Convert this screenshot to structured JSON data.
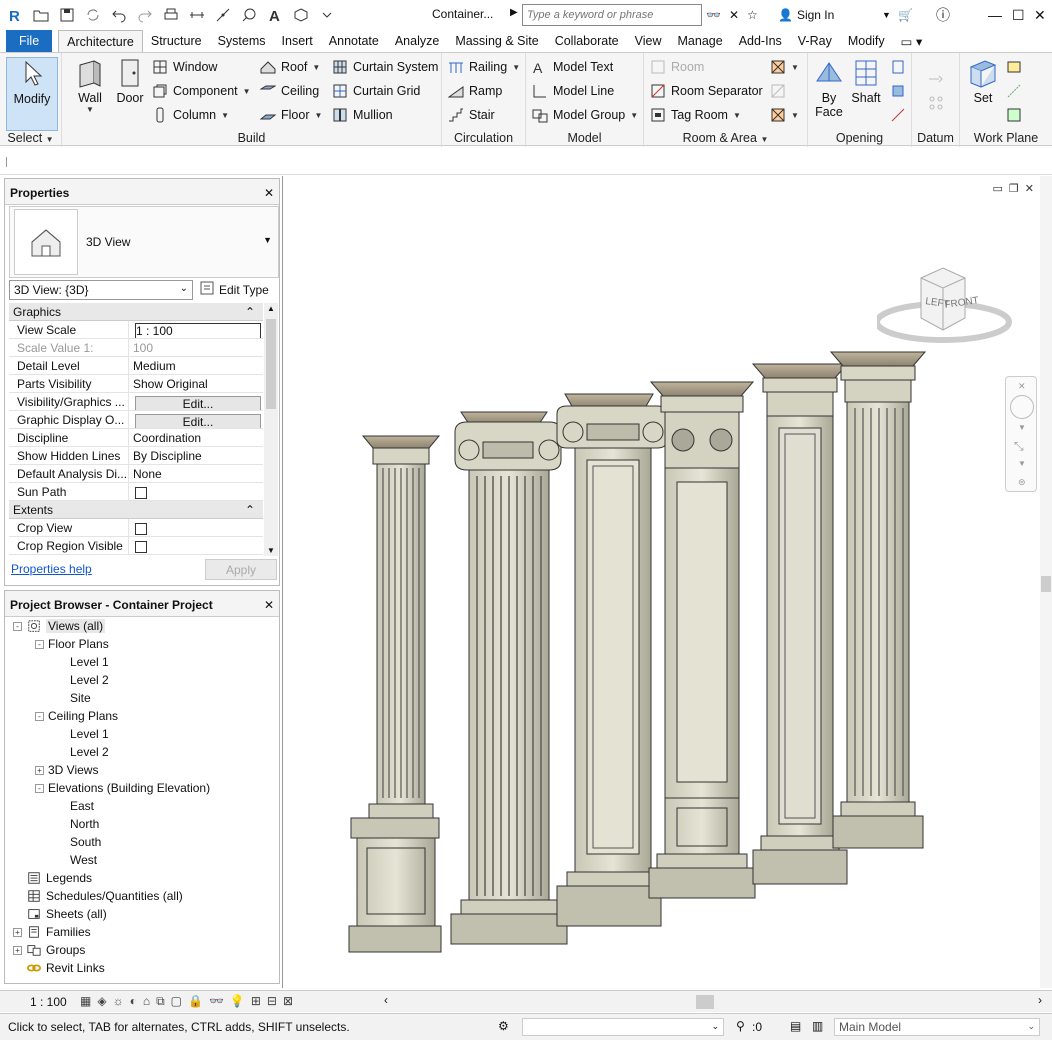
{
  "app": {
    "title": "Container...",
    "search_placeholder": "Type a keyword or phrase",
    "sign_in": "Sign In",
    "accent": "#1b6dc1"
  },
  "tabs": [
    {
      "label": "File"
    },
    {
      "label": "Architecture"
    },
    {
      "label": "Structure"
    },
    {
      "label": "Systems"
    },
    {
      "label": "Insert"
    },
    {
      "label": "Annotate"
    },
    {
      "label": "Analyze"
    },
    {
      "label": "Massing & Site"
    },
    {
      "label": "Collaborate"
    },
    {
      "label": "View"
    },
    {
      "label": "Manage"
    },
    {
      "label": "Add-Ins"
    },
    {
      "label": "V-Ray"
    },
    {
      "label": "Modify"
    }
  ],
  "ribbon": {
    "select": {
      "modify": "Modify",
      "label": "Select"
    },
    "build": {
      "label": "Build",
      "wall": "Wall",
      "door": "Door",
      "window": "Window",
      "component": "Component",
      "column": "Column",
      "roof": "Roof",
      "ceiling": "Ceiling",
      "floor": "Floor",
      "curtain_system": "Curtain  System",
      "curtain_grid": "Curtain  Grid",
      "mullion": "Mullion"
    },
    "circulation": {
      "label": "Circulation",
      "railing": "Railing",
      "ramp": "Ramp",
      "stair": "Stair"
    },
    "model": {
      "label": "Model",
      "model_text": "Model  Text",
      "model_line": "Model  Line",
      "model_group": "Model  Group"
    },
    "room_area": {
      "label": "Room & Area",
      "room": "Room",
      "room_separator": "Room  Separator",
      "tag_room": "Tag  Room"
    },
    "opening": {
      "label": "Opening",
      "by_face": "By Face",
      "shaft": "Shaft"
    },
    "datum": {
      "label": "Datum"
    },
    "work_plane": {
      "label": "Work Plane",
      "set": "Set"
    }
  },
  "properties": {
    "title": "Properties",
    "type_name": "3D View",
    "view_selector": "3D View: {3D}",
    "edit_type": "Edit Type",
    "groups": [
      {
        "name": "Graphics",
        "rows": [
          {
            "name": "View Scale",
            "value": "1 : 100",
            "kind": "input"
          },
          {
            "name": "Scale Value    1:",
            "value": "100",
            "kind": "gray"
          },
          {
            "name": "Detail Level",
            "value": "Medium",
            "kind": "text"
          },
          {
            "name": "Parts Visibility",
            "value": "Show Original",
            "kind": "text"
          },
          {
            "name": "Visibility/Graphics ...",
            "value": "Edit...",
            "kind": "button"
          },
          {
            "name": "Graphic Display O...",
            "value": "Edit...",
            "kind": "button"
          },
          {
            "name": "Discipline",
            "value": "Coordination",
            "kind": "text"
          },
          {
            "name": "Show Hidden Lines",
            "value": "By Discipline",
            "kind": "text"
          },
          {
            "name": "Default Analysis Di...",
            "value": "None",
            "kind": "text"
          },
          {
            "name": "Sun Path",
            "value": "",
            "kind": "check"
          }
        ]
      },
      {
        "name": "Extents",
        "rows": [
          {
            "name": "Crop View",
            "value": "",
            "kind": "check"
          },
          {
            "name": "Crop Region Visible",
            "value": "",
            "kind": "check"
          }
        ]
      }
    ],
    "help": "Properties help",
    "apply": "Apply"
  },
  "browser": {
    "title": "Project Browser - Container Project",
    "nodes": [
      {
        "label": "Views (all)",
        "depth": 0,
        "exp": "-",
        "icon": "views-icon"
      },
      {
        "label": "Floor Plans",
        "depth": 1,
        "exp": "-",
        "icon": ""
      },
      {
        "label": "Level 1",
        "depth": 2,
        "exp": "",
        "icon": ""
      },
      {
        "label": "Level 2",
        "depth": 2,
        "exp": "",
        "icon": ""
      },
      {
        "label": "Site",
        "depth": 2,
        "exp": "",
        "icon": ""
      },
      {
        "label": "Ceiling Plans",
        "depth": 1,
        "exp": "-",
        "icon": ""
      },
      {
        "label": "Level 1",
        "depth": 2,
        "exp": "",
        "icon": ""
      },
      {
        "label": "Level 2",
        "depth": 2,
        "exp": "",
        "icon": ""
      },
      {
        "label": "3D Views",
        "depth": 1,
        "exp": "+",
        "icon": ""
      },
      {
        "label": "Elevations (Building Elevation)",
        "depth": 1,
        "exp": "-",
        "icon": ""
      },
      {
        "label": "East",
        "depth": 2,
        "exp": "",
        "icon": ""
      },
      {
        "label": "North",
        "depth": 2,
        "exp": "",
        "icon": ""
      },
      {
        "label": "South",
        "depth": 2,
        "exp": "",
        "icon": ""
      },
      {
        "label": "West",
        "depth": 2,
        "exp": "",
        "icon": ""
      },
      {
        "label": "Legends",
        "depth": 0,
        "exp": "",
        "icon": "legend-icon"
      },
      {
        "label": "Schedules/Quantities (all)",
        "depth": 0,
        "exp": "",
        "icon": "schedule-icon"
      },
      {
        "label": "Sheets (all)",
        "depth": 0,
        "exp": "",
        "icon": "sheet-icon"
      },
      {
        "label": "Families",
        "depth": 0,
        "exp": "+",
        "icon": "families-icon"
      },
      {
        "label": "Groups",
        "depth": 0,
        "exp": "+",
        "icon": "groups-icon"
      },
      {
        "label": "Revit Links",
        "depth": 0,
        "exp": "",
        "icon": "links-icon"
      }
    ]
  },
  "viewcube": {
    "left": "LEFT",
    "front": "FRONT"
  },
  "view_control": {
    "scale": "1 : 100"
  },
  "status": {
    "text": "Click to select, TAB for alternates, CTRL adds, SHIFT unselects.",
    "filter_count": ":0",
    "model": "Main Model"
  }
}
